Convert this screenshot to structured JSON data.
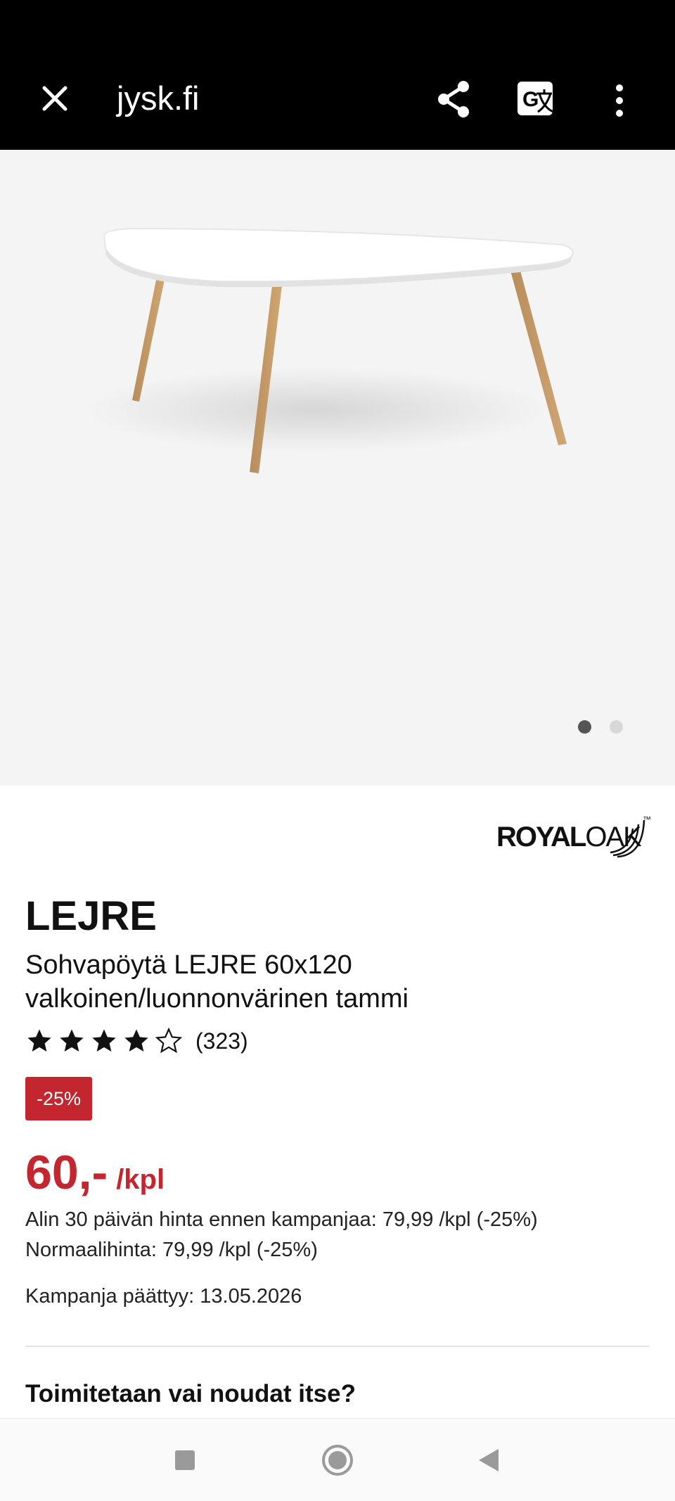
{
  "browser": {
    "url": "jysk.fi",
    "icons": [
      "close-icon",
      "share-icon",
      "translate-icon",
      "more-vert-icon"
    ]
  },
  "gallery": {
    "image_alt": "LEJRE sohvapöytä",
    "total_images": 2,
    "active_index": 0
  },
  "brand": {
    "logo_bold": "ROYAL",
    "logo_light": "OAK",
    "trademark": "™"
  },
  "product": {
    "name": "LEJRE",
    "subtitle": "Sohvapöytä LEJRE 60x120 valkoinen/luonnonvärinen tammi",
    "rating_stars": 4,
    "rating_max": 5,
    "review_count": "(323)",
    "discount_badge": "-25%",
    "price": "60,-",
    "price_unit": "/kpl",
    "lowest_price_text": "Alin 30 päivän hinta ennen kampanjaa: 79,99 /kpl (-25%)",
    "normal_price_text": "Normaalihinta: 79,99 /kpl (-25%)",
    "campaign_end_text": "Kampanja päättyy: 13.05.2026"
  },
  "delivery": {
    "heading": "Toimitetaan vai noudat itse?"
  },
  "colors": {
    "accent_red": "#c3262f",
    "topbar": "#000000",
    "hero_bg": "#f4f4f4"
  },
  "system_nav": [
    "recents-button",
    "home-button",
    "back-button"
  ]
}
